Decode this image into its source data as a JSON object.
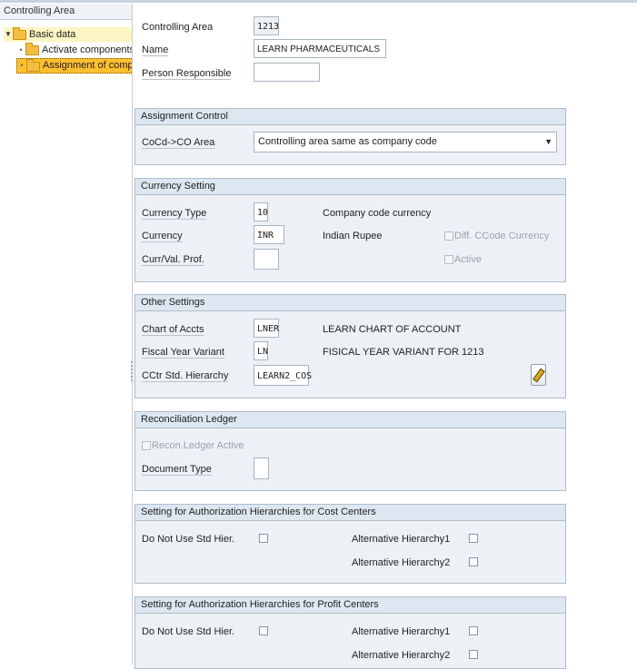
{
  "nav": {
    "header": "Controlling Area",
    "items": [
      {
        "label": "Basic data",
        "icon": "folder-icon"
      },
      {
        "label": "Activate components/control indicators",
        "icon": "folder-icon"
      },
      {
        "label": "Assignment of company code(s)",
        "icon": "folder-icon"
      }
    ]
  },
  "header": {
    "controlling_area": {
      "label": "Controlling Area",
      "value": "1213"
    },
    "name": {
      "label": "Name",
      "value": "LEARN PHARMACEUTICALS"
    },
    "person_responsible": {
      "label": "Person Responsible",
      "value": ""
    }
  },
  "assignment_control": {
    "title": "Assignment Control",
    "cocd_co_area": {
      "label": "CoCd->CO Area",
      "value": "Controlling area same as company code"
    }
  },
  "currency_setting": {
    "title": "Currency Setting",
    "currency_type": {
      "label": "Currency Type",
      "value": "10",
      "text": "Company code currency"
    },
    "currency": {
      "label": "Currency",
      "value": "INR",
      "text": "Indian Rupee"
    },
    "curr_val_prof": {
      "label": "Curr/Val. Prof.",
      "value": ""
    },
    "diff_ccode_currency": {
      "label": "Diff. CCode Currency",
      "checked": false
    },
    "active": {
      "label": "Active",
      "checked": false
    }
  },
  "other_settings": {
    "title": "Other Settings",
    "chart_of_accts": {
      "label": "Chart of Accts",
      "value": "LNER",
      "text": "LEARN CHART OF ACCOUNT"
    },
    "fiscal_year_variant": {
      "label": "Fiscal Year Variant",
      "value": "LN",
      "text": "FISICAL YEAR VARIANT FOR 1213"
    },
    "cctr_std_hierarchy": {
      "label": "CCtr Std. Hierarchy",
      "value": "LEARN2_COS"
    }
  },
  "reconciliation_ledger": {
    "title": "Reconciliation Ledger",
    "recon_ledger_active": {
      "label": "Recon.Ledger Active",
      "checked": false
    },
    "document_type": {
      "label": "Document Type",
      "value": ""
    }
  },
  "auth_cost_centers": {
    "title": "Setting for Authorization Hierarchies for Cost Centers",
    "do_not_use_std": {
      "label": "Do Not Use Std Hier.",
      "checked": false
    },
    "alt1": {
      "label": "Alternative Hierarchy1",
      "checked": false
    },
    "alt2": {
      "label": "Alternative Hierarchy2",
      "checked": false
    }
  },
  "auth_profit_centers": {
    "title": "Setting for Authorization Hierarchies for Profit Centers",
    "do_not_use_std": {
      "label": "Do Not Use Std Hier.",
      "checked": false
    },
    "alt1": {
      "label": "Alternative Hierarchy1",
      "checked": false
    },
    "alt2": {
      "label": "Alternative Hierarchy2",
      "checked": false
    }
  }
}
